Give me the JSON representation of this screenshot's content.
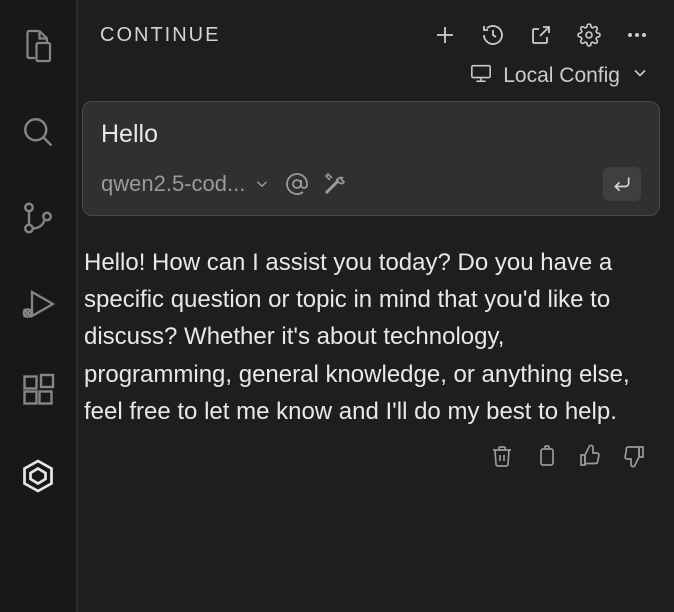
{
  "panel": {
    "title": "CONTINUE"
  },
  "config": {
    "label": "Local Config"
  },
  "input": {
    "text": "Hello",
    "model": "qwen2.5-cod..."
  },
  "response": {
    "text": "Hello! How can I assist you today? Do you have a specific question or topic in mind that you'd like to discuss? Whether it's about technology, programming, general knowledge, or anything else, feel free to let me know and I'll do my best to help."
  }
}
